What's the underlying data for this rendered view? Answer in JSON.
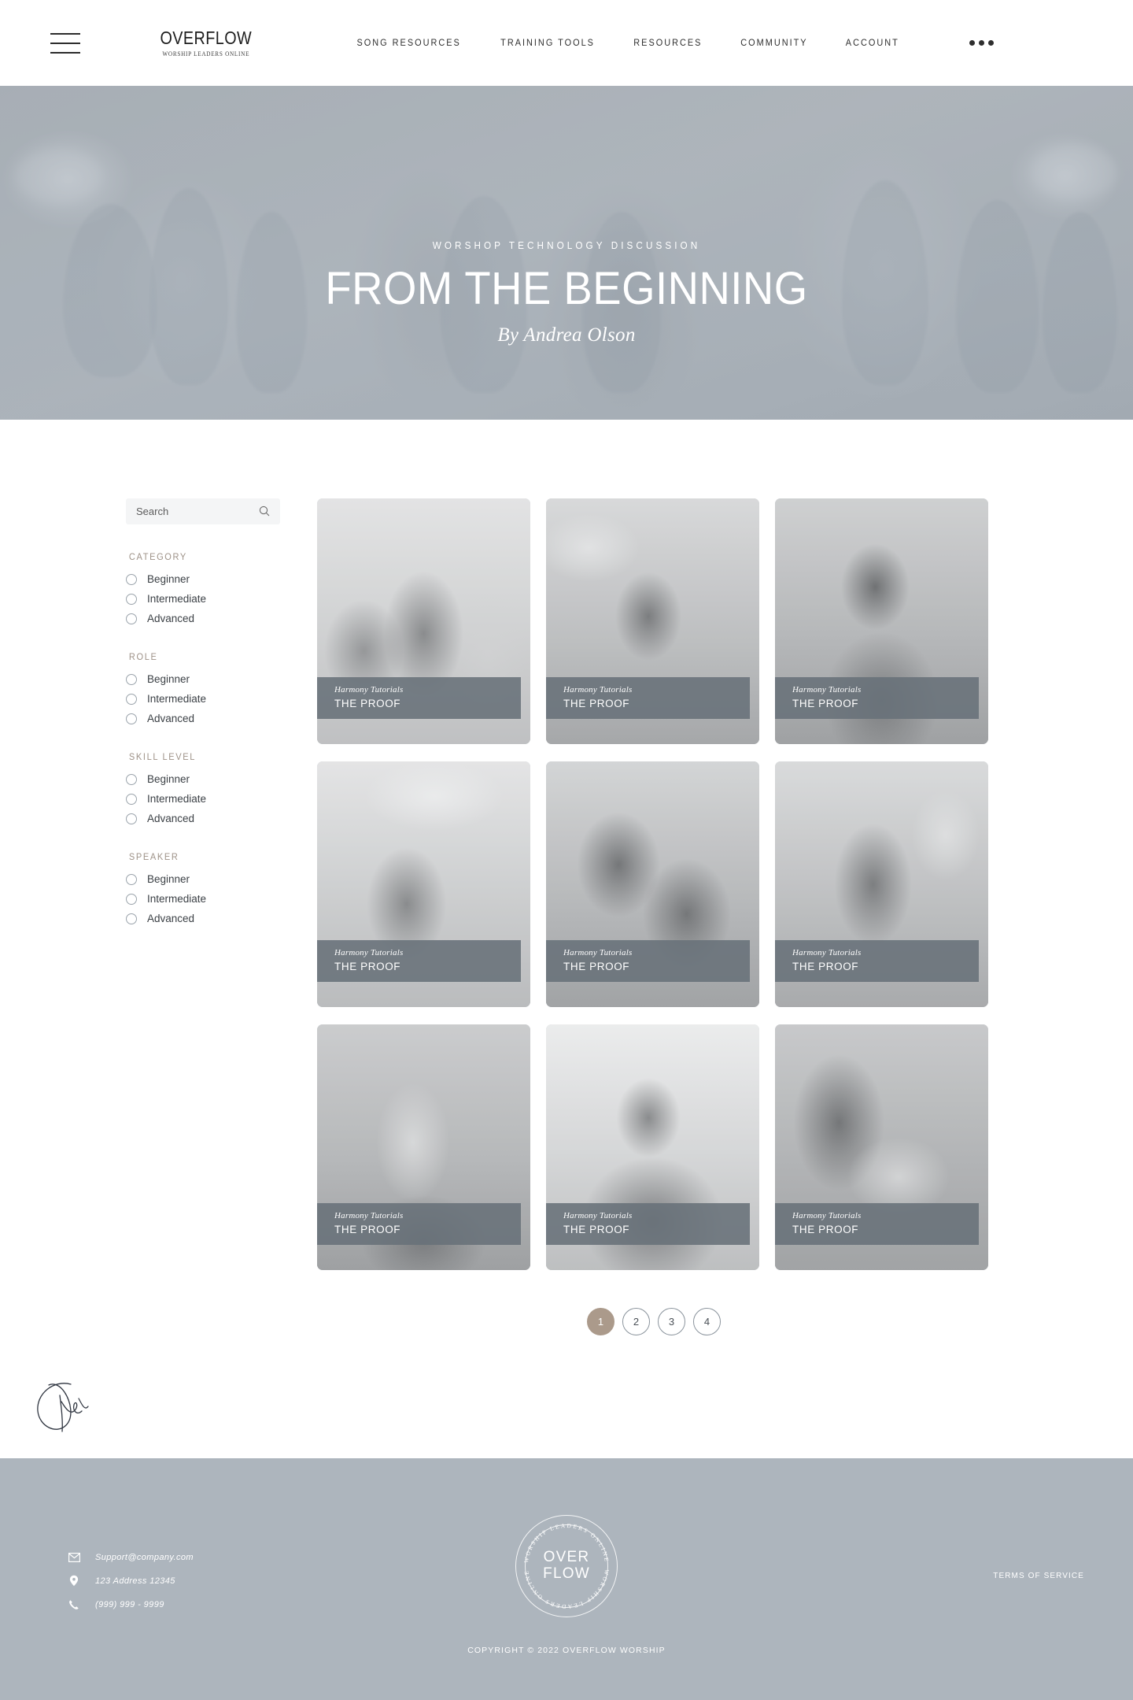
{
  "header": {
    "menu_icon": "hamburger-icon",
    "brand": {
      "name": "OVERFLOW",
      "tagline": "WORSHIP LEADERS ONLINE"
    },
    "nav": [
      {
        "label": "SONG RESOURCES"
      },
      {
        "label": "TRAINING TOOLS"
      },
      {
        "label": "RESOURCES"
      },
      {
        "label": "COMMUNITY"
      },
      {
        "label": "ACCOUNT"
      }
    ],
    "more_icon": "ellipsis-icon"
  },
  "hero": {
    "eyebrow": "WORSHOP TECHNOLOGY DISCUSSION",
    "title": "FROM THE BEGINNING",
    "byline": "By Andrea Olson"
  },
  "sidebar": {
    "search": {
      "value": "",
      "placeholder": "Search",
      "icon": "search-icon"
    },
    "filters": [
      {
        "title": "CATEGORY",
        "options": [
          "Beginner",
          "Intermediate",
          "Advanced"
        ]
      },
      {
        "title": "ROLE",
        "options": [
          "Beginner",
          "Intermediate",
          "Advanced"
        ]
      },
      {
        "title": "SKILL LEVEL",
        "options": [
          "Beginner",
          "Intermediate",
          "Advanced"
        ]
      },
      {
        "title": "SPEAKER",
        "options": [
          "Beginner",
          "Intermediate",
          "Advanced"
        ]
      }
    ]
  },
  "grid": {
    "cards": [
      {
        "subtitle": "Harmony Tutorials",
        "title": "THE PROOF"
      },
      {
        "subtitle": "Harmony Tutorials",
        "title": "THE PROOF"
      },
      {
        "subtitle": "Harmony Tutorials",
        "title": "THE PROOF"
      },
      {
        "subtitle": "Harmony Tutorials",
        "title": "THE PROOF"
      },
      {
        "subtitle": "Harmony Tutorials",
        "title": "THE PROOF"
      },
      {
        "subtitle": "Harmony Tutorials",
        "title": "THE PROOF"
      },
      {
        "subtitle": "Harmony Tutorials",
        "title": "THE PROOF"
      },
      {
        "subtitle": "Harmony Tutorials",
        "title": "THE PROOF"
      },
      {
        "subtitle": "Harmony Tutorials",
        "title": "THE PROOF"
      }
    ]
  },
  "pagination": {
    "pages": [
      "1",
      "2",
      "3",
      "4"
    ],
    "active_index": 0,
    "active_color": "#ab9a8b"
  },
  "footer": {
    "contact": [
      {
        "icon": "mail-icon",
        "text": "Support@company.com"
      },
      {
        "icon": "pin-icon",
        "text": "123 Address 12345"
      },
      {
        "icon": "phone-icon",
        "text": "(999) 999 - 9999"
      }
    ],
    "badge": {
      "ring_text": "WORSHIP LEADERS ONLINE",
      "line1": "OVER",
      "line2": "FLOW"
    },
    "terms_label": "TERMS OF SERVICE",
    "copyright": "COPYRIGHT © 2022 OVERFLOW WORSHIP",
    "background_color": "#adb5bd"
  },
  "theme": {
    "hero_overlay": "#a8b2bc",
    "caption_bar": "#687179",
    "filter_heading": "#9e9288"
  }
}
